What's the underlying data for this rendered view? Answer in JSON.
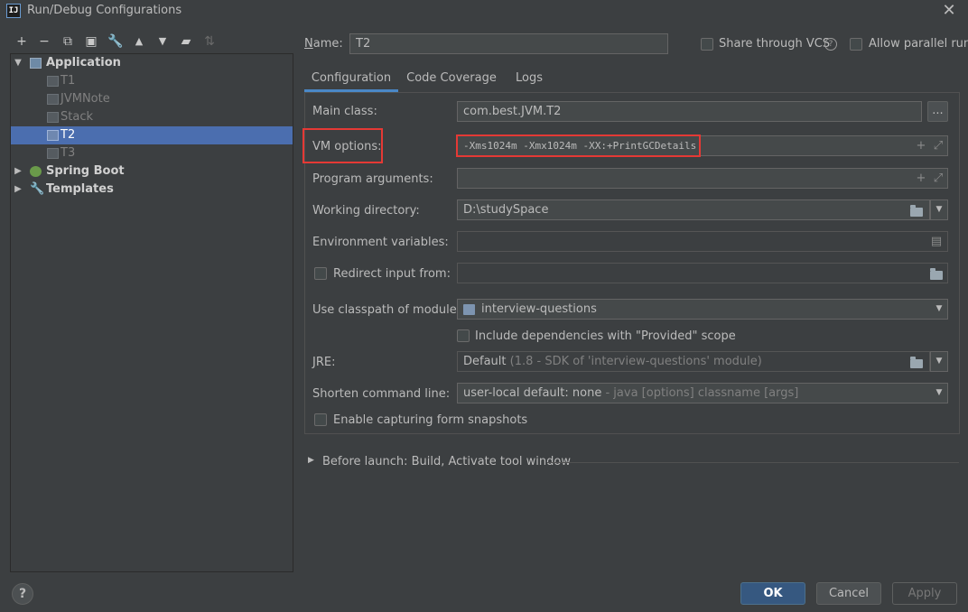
{
  "window": {
    "title": "Run/Debug Configurations"
  },
  "tree": {
    "application": {
      "label": "Application",
      "items": [
        "T1",
        "JVMNote",
        "Stack",
        "T2",
        "T3"
      ],
      "selected": "T2"
    },
    "spring_boot": "Spring Boot",
    "templates": "Templates"
  },
  "header": {
    "name_label": "Name:",
    "name_value": "T2",
    "share_vcs": "Share through VCS",
    "allow_parallel": "Allow parallel run"
  },
  "tabs": [
    "Configuration",
    "Code Coverage",
    "Logs"
  ],
  "form": {
    "main_class_label": "Main class:",
    "main_class_value": "com.best.JVM.T2",
    "browse_label": "...",
    "vm_options_label": "VM options:",
    "vm_options_value": "-Xms1024m -Xmx1024m -XX:+PrintGCDetails",
    "program_args_label": "Program arguments:",
    "working_dir_label": "Working directory:",
    "working_dir_value": "D:\\studySpace",
    "env_vars_label": "Environment variables:",
    "redirect_input_label": "Redirect input from:",
    "classpath_label": "Use classpath of module:",
    "classpath_value": "interview-questions",
    "include_deps_label": "Include dependencies with \"Provided\" scope",
    "jre_label": "JRE:",
    "jre_value": "Default",
    "jre_hint": "(1.8 - SDK of 'interview-questions' module)",
    "shorten_label": "Shorten command line:",
    "shorten_value": "user-local default: none",
    "shorten_hint": "- java [options] classname [args]",
    "snapshots_label": "Enable capturing form snapshots"
  },
  "before_launch": "Before launch: Build, Activate tool window",
  "buttons": {
    "ok": "OK",
    "cancel": "Cancel",
    "apply": "Apply",
    "help": "?"
  },
  "colors": {
    "background": "#3c3f41",
    "selection": "#4b6eaf",
    "primary_button": "#365880",
    "highlight_box": "#e53935"
  }
}
